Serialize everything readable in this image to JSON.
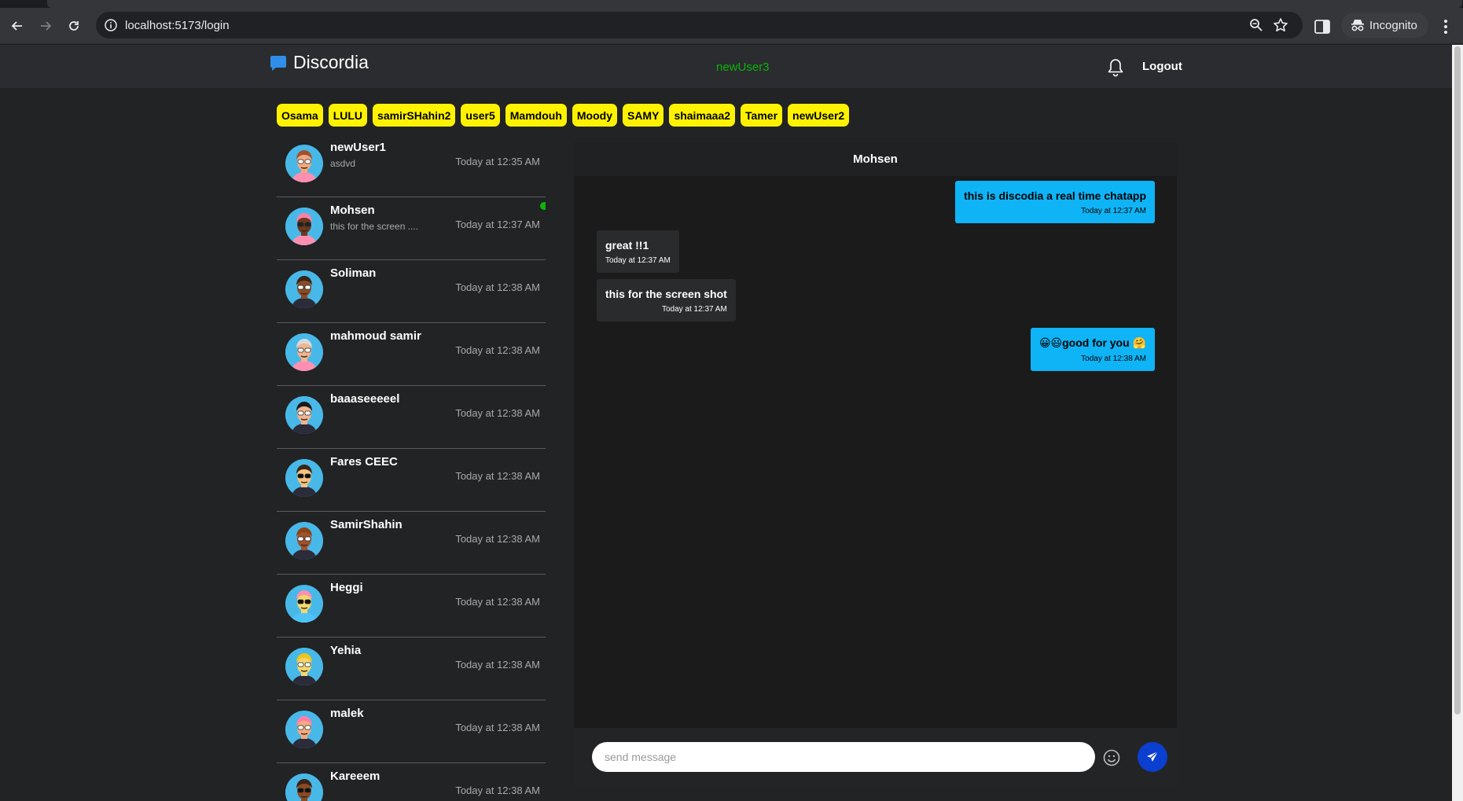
{
  "browser": {
    "url": "localhost:5173/login",
    "incognito_label": "Incognito"
  },
  "app": {
    "brand": "Discordia",
    "current_user": "newUser3",
    "logout_label": "Logout"
  },
  "online_users": [
    "Osama",
    "LULU",
    "samirSHahin2",
    "user5",
    "Mamdouh",
    "Moody",
    "SAMY",
    "shaimaaa2",
    "Tamer",
    "newUser2"
  ],
  "conversations": [
    {
      "name": "newUser1",
      "preview": "asdvd",
      "time": "Today at 12:35 AM",
      "online": false,
      "avatar": {
        "bg": "#48b8e8",
        "skin": "#f5a97f",
        "hair": "#a0522d",
        "shirt": "#ff8fb1",
        "glasses": "#ffffff"
      }
    },
    {
      "name": "Mohsen",
      "preview": "this for the screen ....",
      "time": "Today at 12:37 AM",
      "online": true,
      "avatar": {
        "bg": "#48b8e8",
        "skin": "#6b3a1e",
        "hair": "#ff7fa8",
        "shirt": "#ff8fb1",
        "glasses": "#222222"
      }
    },
    {
      "name": "Soliman",
      "preview": "",
      "time": "Today at 12:38 AM",
      "online": false,
      "avatar": {
        "bg": "#48b8e8",
        "skin": "#8a4b25",
        "hair": "#3a2418",
        "shirt": "#2b2b3a",
        "glasses": "#ffffff"
      }
    },
    {
      "name": "mahmoud samir",
      "preview": "",
      "time": "Today at 12:38 AM",
      "online": false,
      "avatar": {
        "bg": "#48b8e8",
        "skin": "#f0b48e",
        "hair": "#d9d9d9",
        "shirt": "#ff8fb1",
        "glasses": "#ffffff"
      }
    },
    {
      "name": "baaaseeeeel",
      "preview": "",
      "time": "Today at 12:38 AM",
      "online": false,
      "avatar": {
        "bg": "#48b8e8",
        "skin": "#f0b48e",
        "hair": "#1a1a1a",
        "shirt": "#2b2b3a",
        "glasses": "#ffffff"
      }
    },
    {
      "name": "Fares CEEC",
      "preview": "",
      "time": "Today at 12:38 AM",
      "online": false,
      "avatar": {
        "bg": "#48b8e8",
        "skin": "#f5c27f",
        "hair": "#3a2418",
        "shirt": "#2b2b3a",
        "glasses": "#111111"
      }
    },
    {
      "name": "SamirShahin",
      "preview": "",
      "time": "Today at 12:38 AM",
      "online": false,
      "avatar": {
        "bg": "#48b8e8",
        "skin": "#a0522d",
        "hair": "#8b4513",
        "shirt": "#2b2b3a",
        "glasses": "#ffffff"
      }
    },
    {
      "name": "Heggi",
      "preview": "",
      "time": "Today at 12:38 AM",
      "online": false,
      "avatar": {
        "bg": "#48b8e8",
        "skin": "#f5d76e",
        "hair": "#ff8fb1",
        "shirt": "#4fc3f7",
        "glasses": "#111111"
      }
    },
    {
      "name": "Yehia",
      "preview": "",
      "time": "Today at 12:38 AM",
      "online": false,
      "avatar": {
        "bg": "#48b8e8",
        "skin": "#f5d76e",
        "hair": "#f0c419",
        "shirt": "#2b2b3a",
        "glasses": "#ffffff"
      }
    },
    {
      "name": "malek",
      "preview": "",
      "time": "Today at 12:38 AM",
      "online": false,
      "avatar": {
        "bg": "#48b8e8",
        "skin": "#f5a97f",
        "hair": "#ff7fa8",
        "shirt": "#2b2b3a",
        "glasses": "#ffffff"
      }
    },
    {
      "name": "Kareeem",
      "preview": "",
      "time": "Today at 12:38 AM",
      "online": false,
      "avatar": {
        "bg": "#48b8e8",
        "skin": "#8a4b25",
        "hair": "#3a2418",
        "shirt": "#2b2b3a",
        "glasses": "#111111"
      }
    }
  ],
  "chat": {
    "title": "Mohsen",
    "messages": [
      {
        "direction": "out",
        "text": "this is discodia a real time chatapp",
        "time": "Today at 12:37 AM"
      },
      {
        "direction": "in",
        "text": "great !!1",
        "time": "Today at 12:37 AM"
      },
      {
        "direction": "in",
        "text": "this for the screen shot",
        "time": "Today at 12:37 AM"
      },
      {
        "direction": "out",
        "text": "😀😃good for you 🤗",
        "time": "Today at 12:38 AM"
      }
    ],
    "composer_placeholder": "send message"
  },
  "colors": {
    "chip": "#fff200",
    "outgoing": "#0eb4f5",
    "incoming": "#2a2b2d",
    "online": "#0bb30b",
    "send": "#0a3fd0"
  }
}
